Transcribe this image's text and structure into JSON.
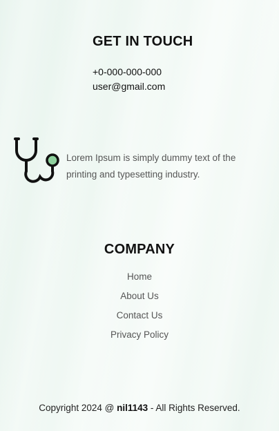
{
  "contact": {
    "heading": "GET IN TOUCH",
    "phone": "+0-000-000-000",
    "email": "user@gmail.com"
  },
  "mission": {
    "icon": "stethoscope-icon",
    "text": "Lorem Ipsum is simply dummy text of the printing and typesetting industry."
  },
  "company": {
    "heading": "COMPANY",
    "links": [
      "Home",
      "About Us",
      "Contact Us",
      "Privacy Policy"
    ]
  },
  "footer": {
    "prefix": "Copyright 2024 @ ",
    "brand": "nil1143",
    "suffix": " - All Rights Reserved."
  },
  "colors": {
    "icon_accent": "#8fd19e",
    "text_muted": "#555555"
  }
}
